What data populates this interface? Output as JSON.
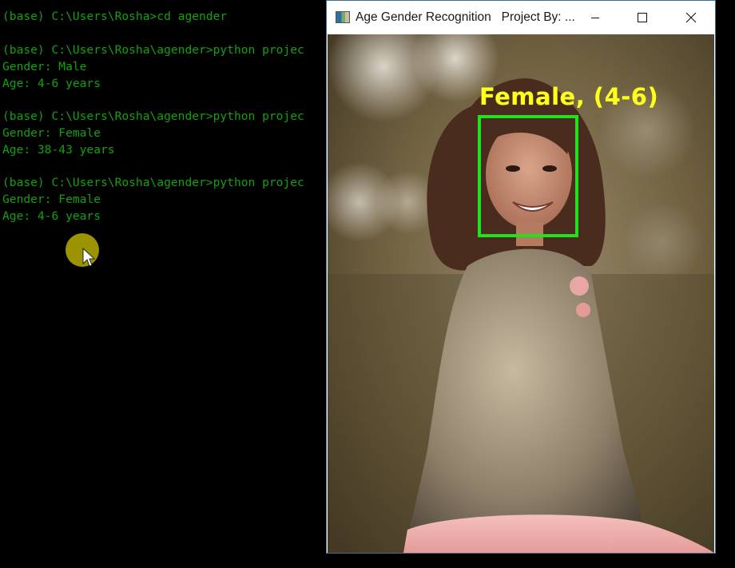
{
  "terminal": {
    "text_color": "#13a10e",
    "background": "#000000",
    "lines": [
      "(base) C:\\Users\\Rosha>cd agender",
      "",
      "(base) C:\\Users\\Rosha\\agender>python projec",
      "Gender: Male",
      "Age: 4-6 years",
      "",
      "(base) C:\\Users\\Rosha\\agender>python projec",
      "Gender: Female",
      "Age: 38-43 years",
      "",
      "(base) C:\\Users\\Rosha\\agender>python projec",
      "Gender: Female",
      "Age: 4-6 years"
    ]
  },
  "window": {
    "title": "Age Gender Recognition   Project By: ...",
    "icon": "image-window-icon",
    "controls": {
      "minimize": "minimize-icon",
      "maximize": "maximize-icon",
      "close": "close-icon"
    }
  },
  "photo": {
    "overlay_label": "Female, (4-6)",
    "box_color": "#1ee41e",
    "label_color": "#ffff1e"
  }
}
